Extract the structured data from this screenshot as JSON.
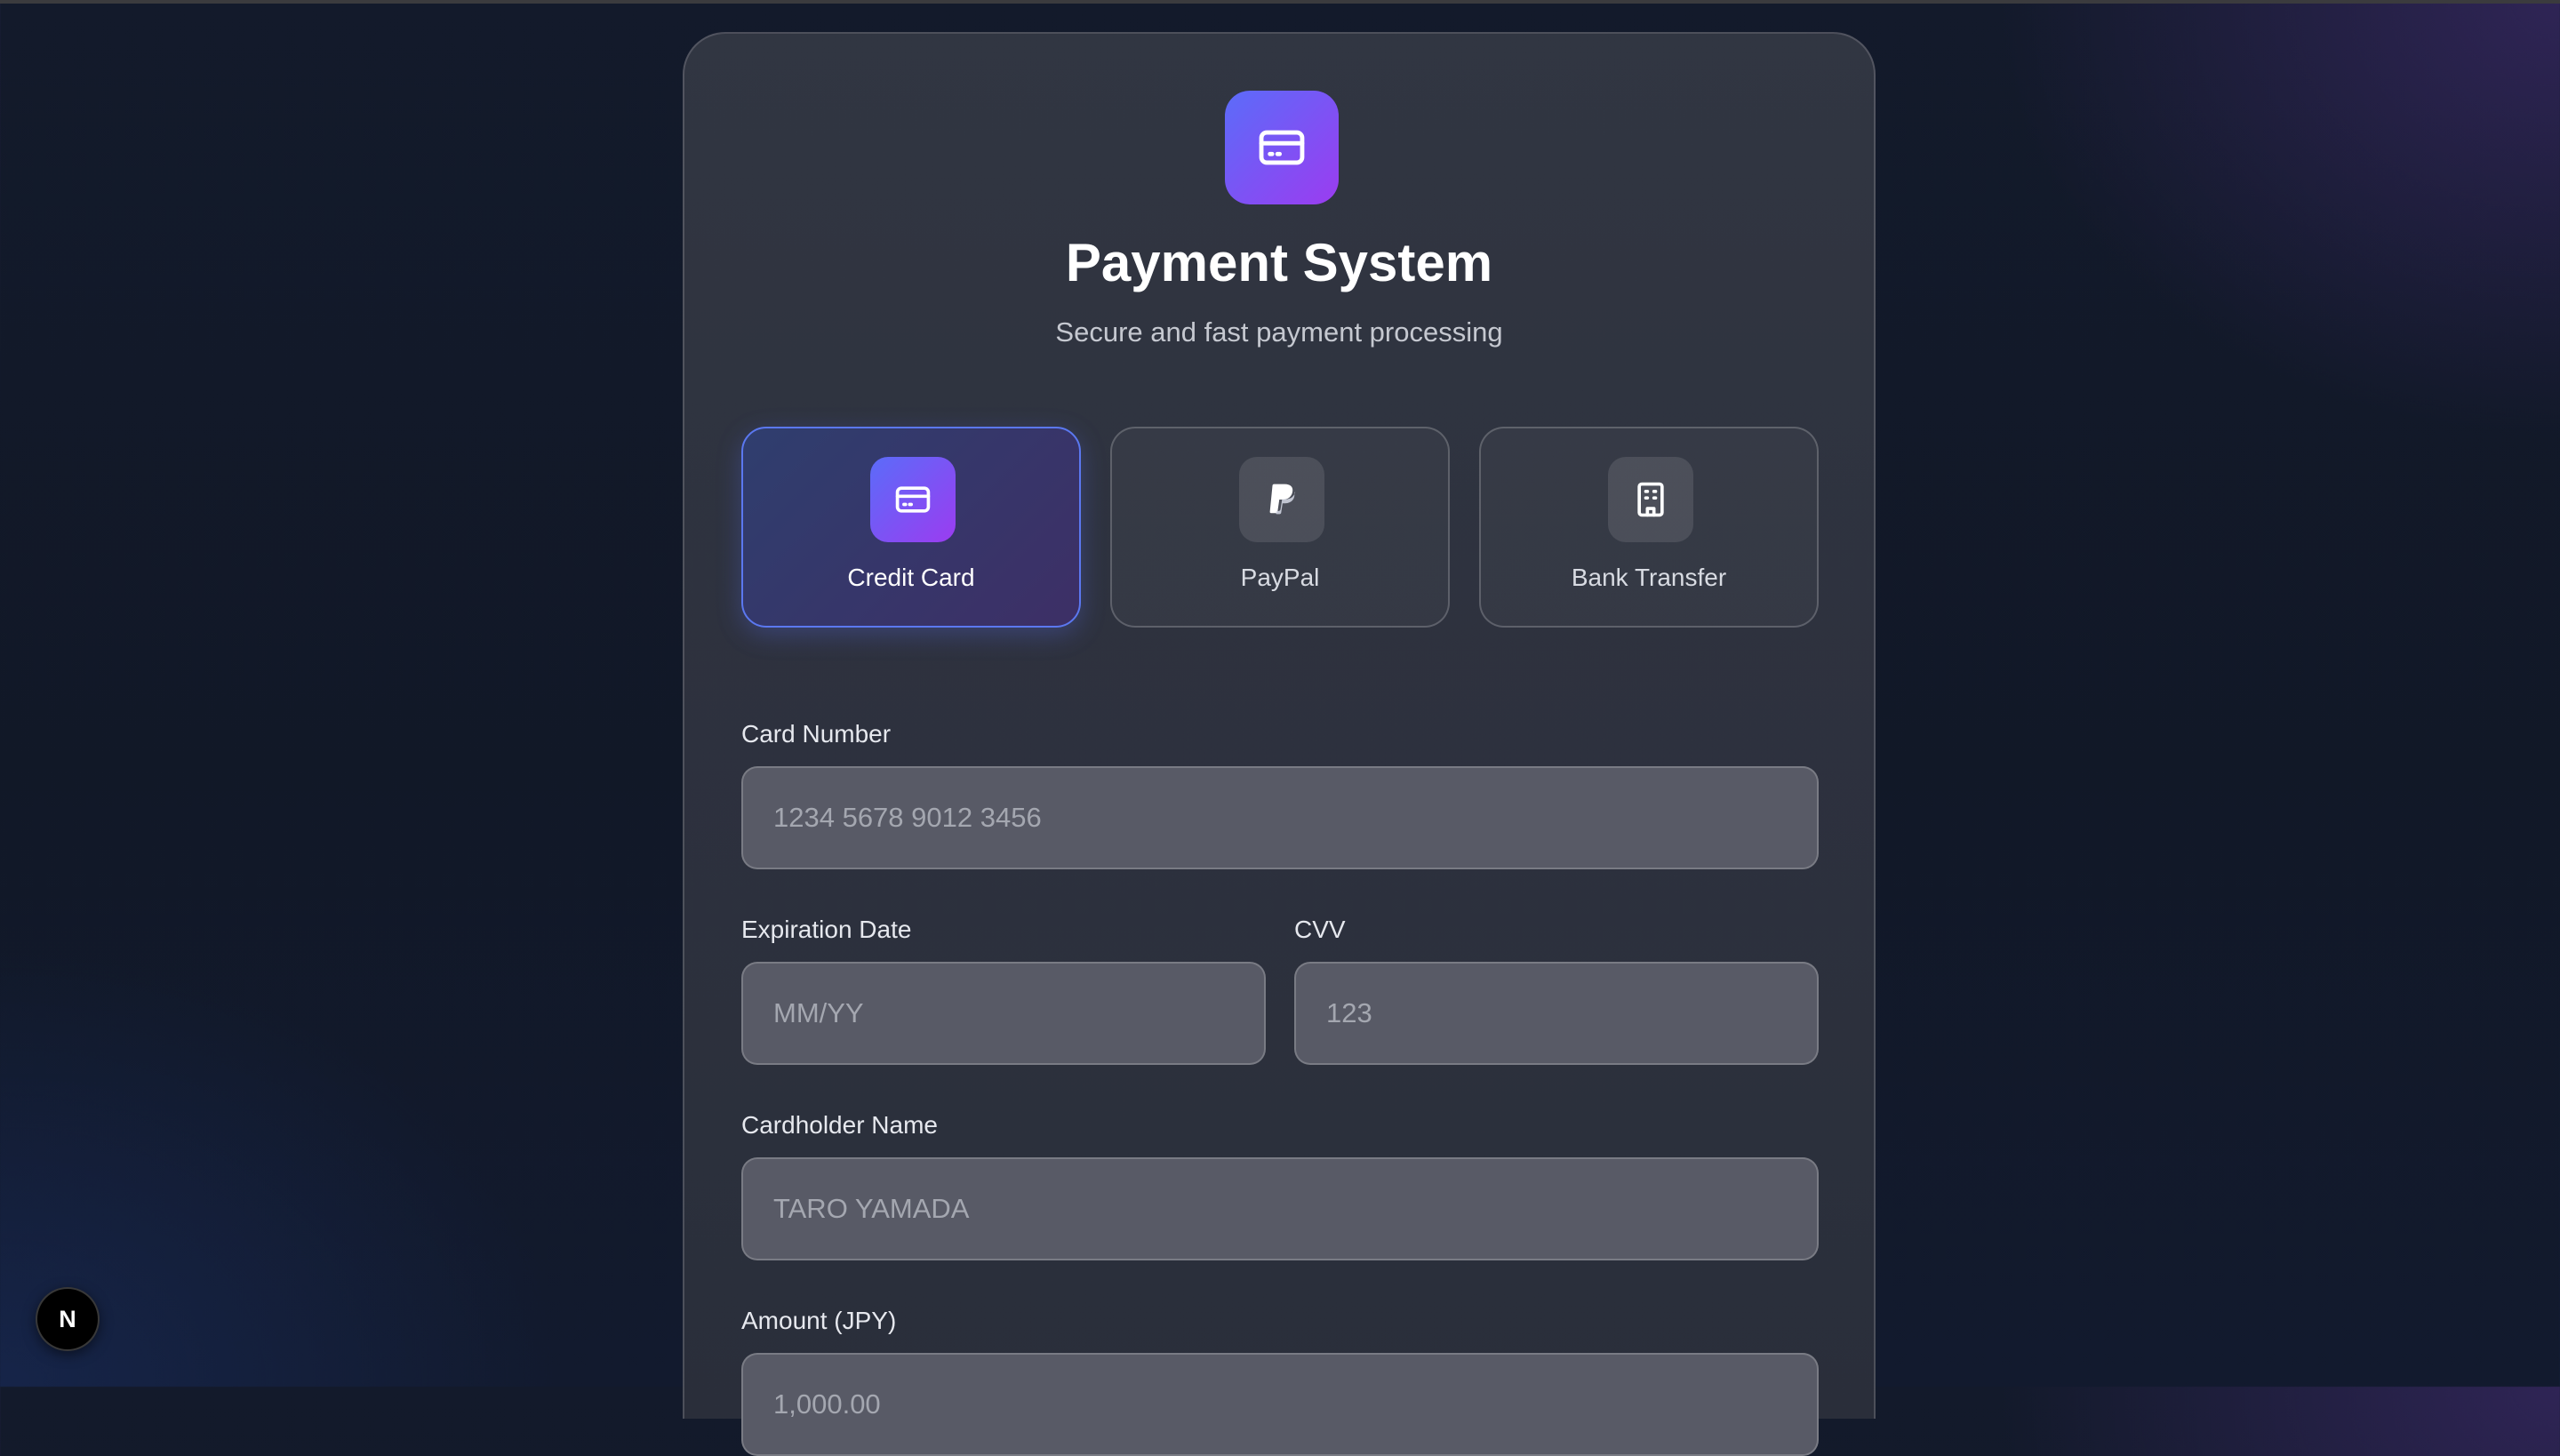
{
  "header": {
    "title": "Payment System",
    "subtitle": "Secure and fast payment processing",
    "icon": "credit-card-icon"
  },
  "payment_methods": [
    {
      "label": "Credit Card",
      "icon": "credit-card-icon",
      "selected": true
    },
    {
      "label": "PayPal",
      "icon": "paypal-icon",
      "selected": false
    },
    {
      "label": "Bank Transfer",
      "icon": "building-icon",
      "selected": false
    }
  ],
  "form": {
    "card_number": {
      "label": "Card Number",
      "placeholder": "1234 5678 9012 3456",
      "value": ""
    },
    "expiration": {
      "label": "Expiration Date",
      "placeholder": "MM/YY",
      "value": ""
    },
    "cvv": {
      "label": "CVV",
      "placeholder": "123",
      "value": ""
    },
    "cardholder": {
      "label": "Cardholder Name",
      "placeholder": "TARO YAMADA",
      "value": ""
    },
    "amount": {
      "label": "Amount (JPY)",
      "placeholder": "1,000.00",
      "value": ""
    }
  },
  "dev_badge": {
    "label": "N"
  },
  "colors": {
    "accent_start": "#5b6cf9",
    "accent_end": "#9b3cf0",
    "selected_border": "#5b78f0"
  }
}
